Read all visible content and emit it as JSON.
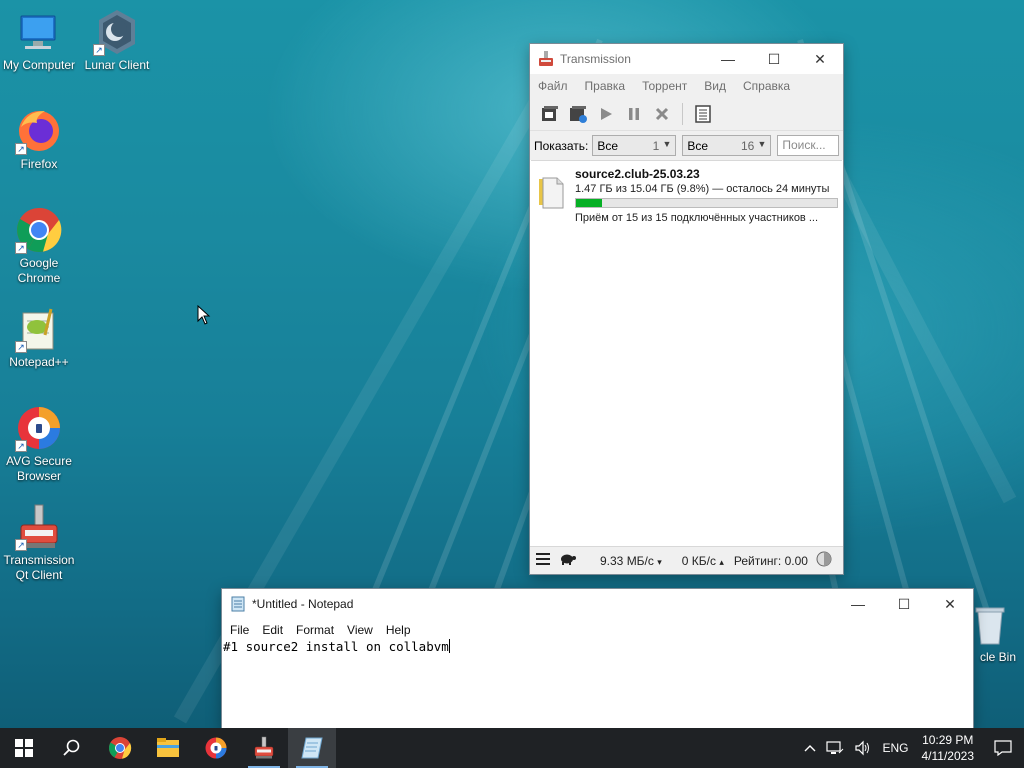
{
  "desktop": {
    "icons": [
      {
        "label": "My Computer"
      },
      {
        "label": "Lunar Client"
      },
      {
        "label": "Firefox"
      },
      {
        "label": "Google Chrome"
      },
      {
        "label": "Notepad++"
      },
      {
        "label": "AVG Secure Browser"
      },
      {
        "label": "Transmission Qt Client"
      },
      {
        "label": "cle Bin"
      }
    ]
  },
  "transmission": {
    "title": "Transmission",
    "menu": [
      "Файл",
      "Правка",
      "Торрент",
      "Вид",
      "Справка"
    ],
    "filter": {
      "show_label": "Показать:",
      "status": {
        "value": "Все",
        "count": "1"
      },
      "tracker": {
        "value": "Все",
        "count": "16"
      },
      "search_placeholder": "Поиск..."
    },
    "torrents": [
      {
        "name": "source2.club-25.03.23",
        "progress_text": "1.47 ГБ из 15.04 ГБ (9.8%) — осталось 24 минуты",
        "progress_fraction": 0.098,
        "peers_text": "Приём от 15 из 15 подключённых участников ..."
      }
    ],
    "status": {
      "down": "9.33 МБ/с",
      "up": "0 КБ/с",
      "ratio": "Рейтинг: 0.00"
    }
  },
  "notepad": {
    "title": "*Untitled - Notepad",
    "menu": [
      "File",
      "Edit",
      "Format",
      "View",
      "Help"
    ],
    "content": "#1 source2 install on collabvm"
  },
  "taskbar": {
    "language": "ENG",
    "time": "10:29 PM",
    "date": "4/11/2023"
  },
  "colors": {
    "progress_fill": "#06b025",
    "taskbar": "#1f2225"
  }
}
